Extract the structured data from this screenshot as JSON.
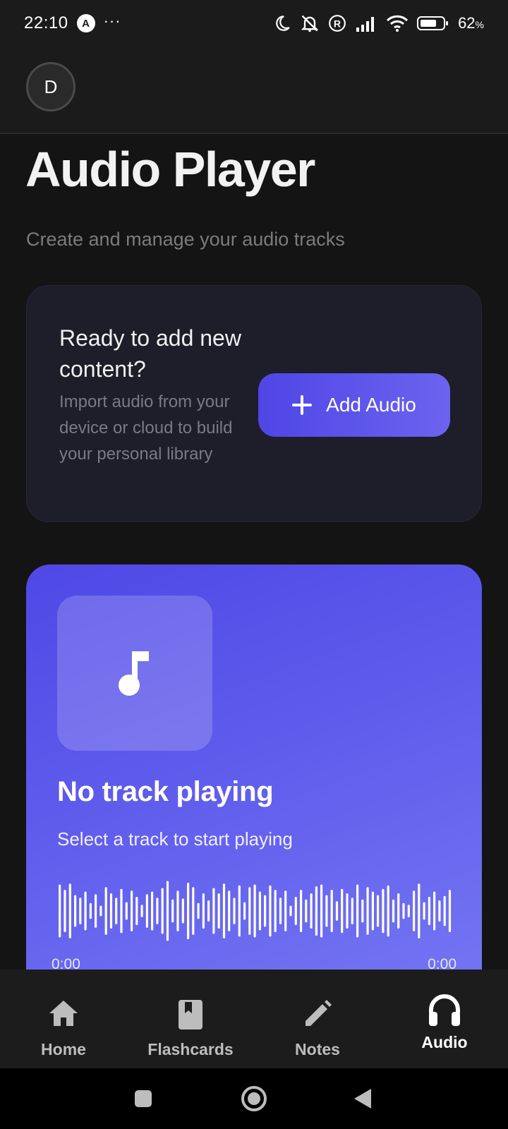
{
  "status_bar": {
    "time": "22:10",
    "app_badge": "A",
    "more": "···",
    "battery_percent": "62",
    "battery_unit": "%"
  },
  "header": {
    "avatar_initial": "D"
  },
  "page": {
    "title": "Audio Player",
    "subtitle": "Create and manage your audio tracks"
  },
  "add_card": {
    "title": "Ready to add new content?",
    "description": "Import audio from your device or cloud to build your personal library",
    "button_label": "Add Audio"
  },
  "player": {
    "track_title": "No track playing",
    "track_subtitle": "Select a track to start playing",
    "time_current": "0:00",
    "time_total": "0:00",
    "accent_start": "#4f46e5",
    "accent_end": "#7a7cf4"
  },
  "bottom_nav": {
    "items": [
      {
        "label": "Home",
        "icon": "home-icon",
        "active": false
      },
      {
        "label": "Flashcards",
        "icon": "book-icon",
        "active": false
      },
      {
        "label": "Notes",
        "icon": "pencil-icon",
        "active": false
      },
      {
        "label": "Audio",
        "icon": "headphones-icon",
        "active": true
      }
    ]
  }
}
